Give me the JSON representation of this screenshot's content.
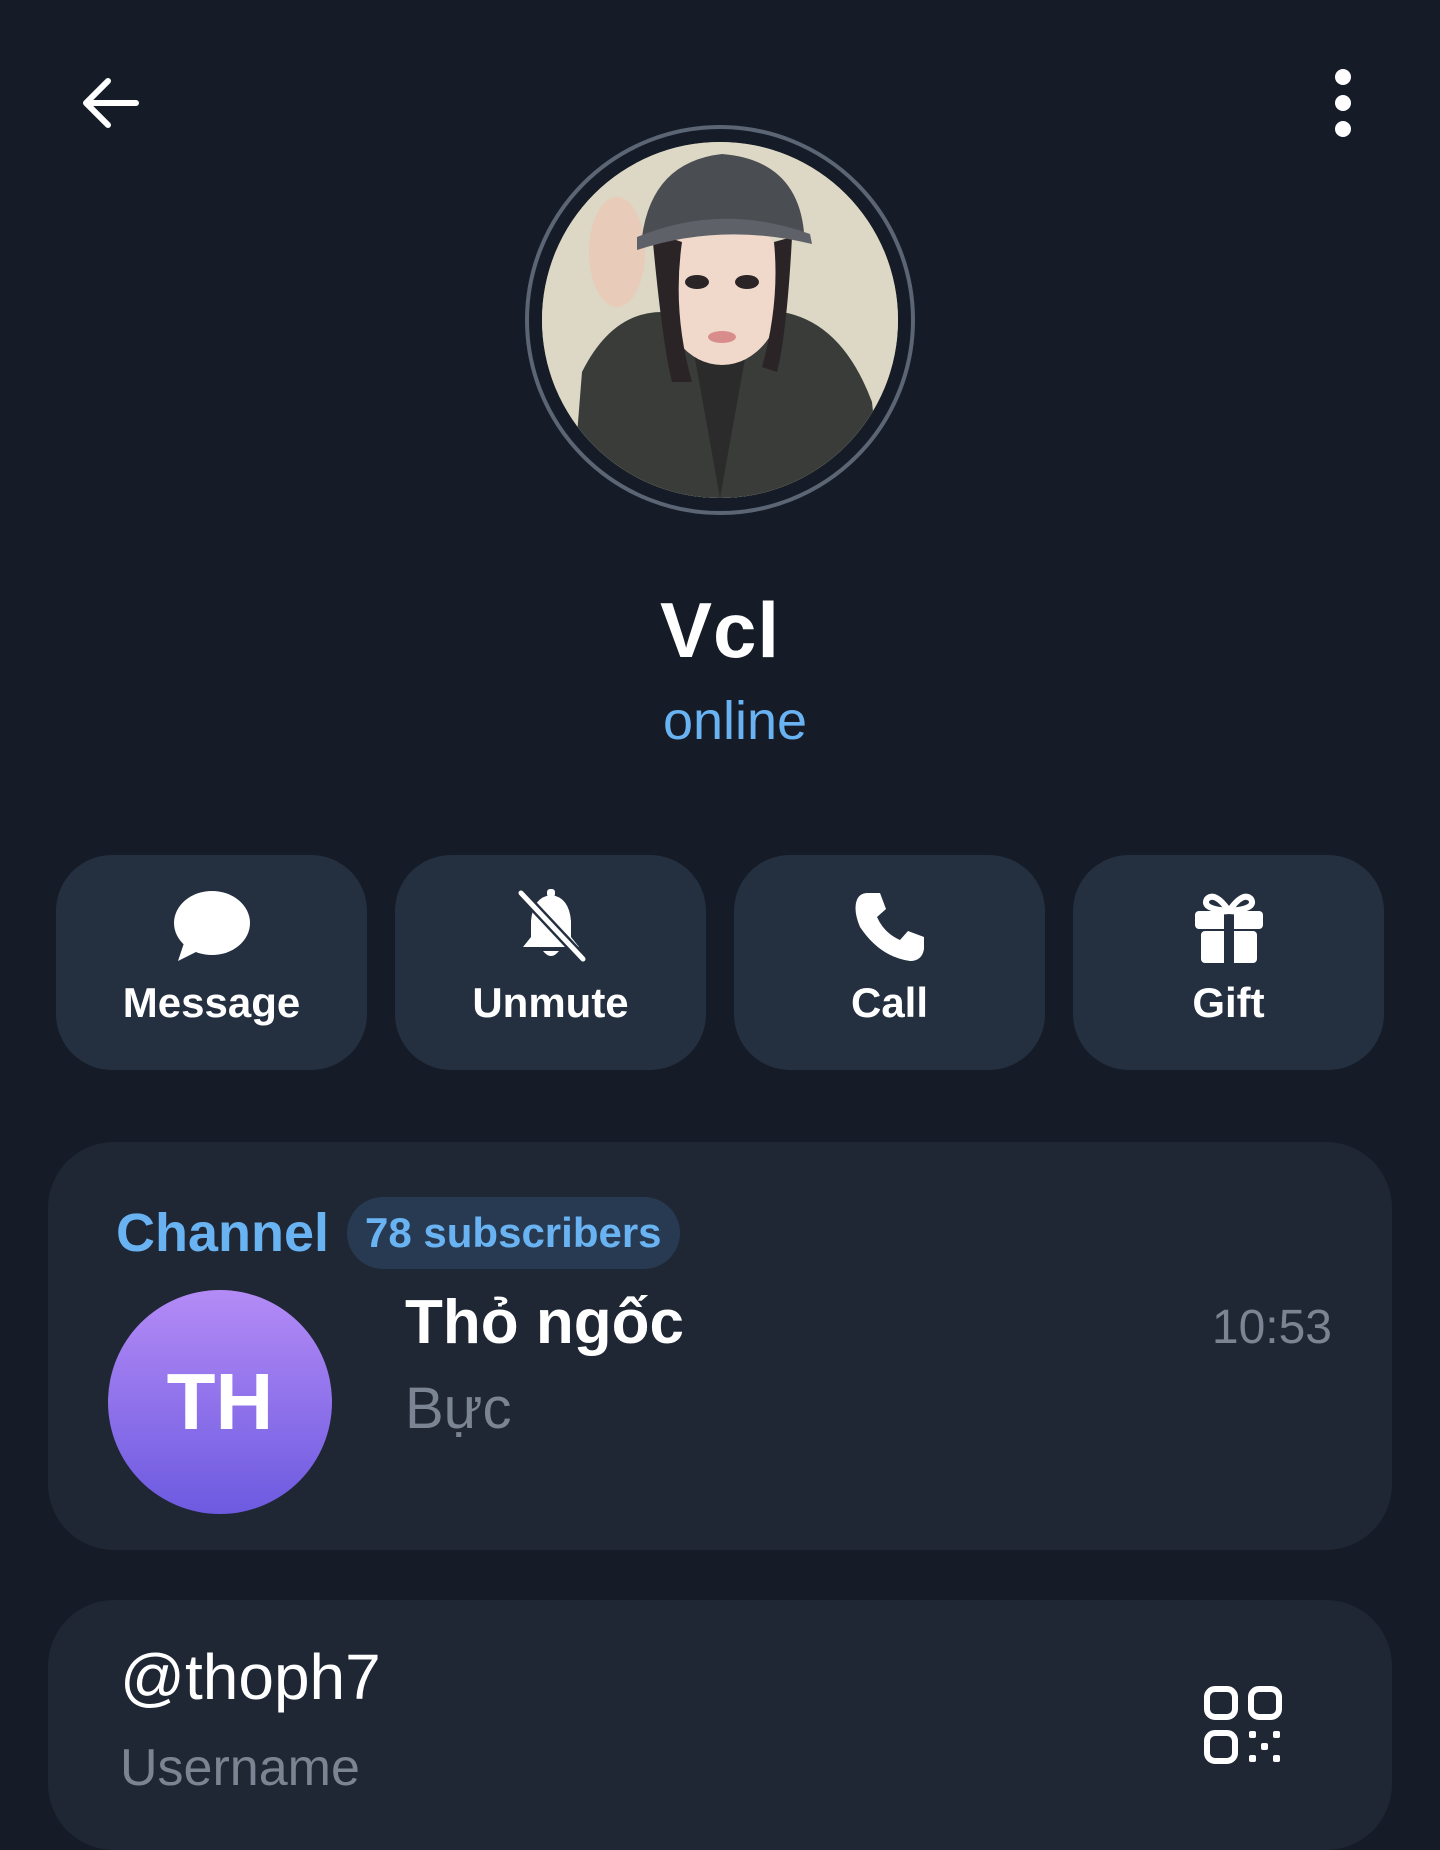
{
  "header": {
    "back_icon": "arrow-left-icon",
    "more_icon": "more-vertical-icon"
  },
  "profile": {
    "name": "Vcl",
    "status": "online",
    "status_color": "#6ab3f3"
  },
  "actions": [
    {
      "label": "Message",
      "icon": "message-bubble-icon"
    },
    {
      "label": "Unmute",
      "icon": "bell-off-icon"
    },
    {
      "label": "Call",
      "icon": "phone-icon"
    },
    {
      "label": "Gift",
      "icon": "gift-icon"
    }
  ],
  "channel": {
    "label": "Channel",
    "subscribers": "78 subscribers",
    "avatar_initials": "TH",
    "name": "Thỏ ngốc",
    "last_message": "Bực",
    "time": "10:53"
  },
  "username": {
    "value": "@thoph7",
    "label": "Username",
    "icon": "qr-code-icon"
  },
  "colors": {
    "background": "#151c27",
    "card": "#1f2734",
    "action_button": "#243040",
    "accent": "#6ab3f3",
    "secondary_text": "#7a8492"
  }
}
